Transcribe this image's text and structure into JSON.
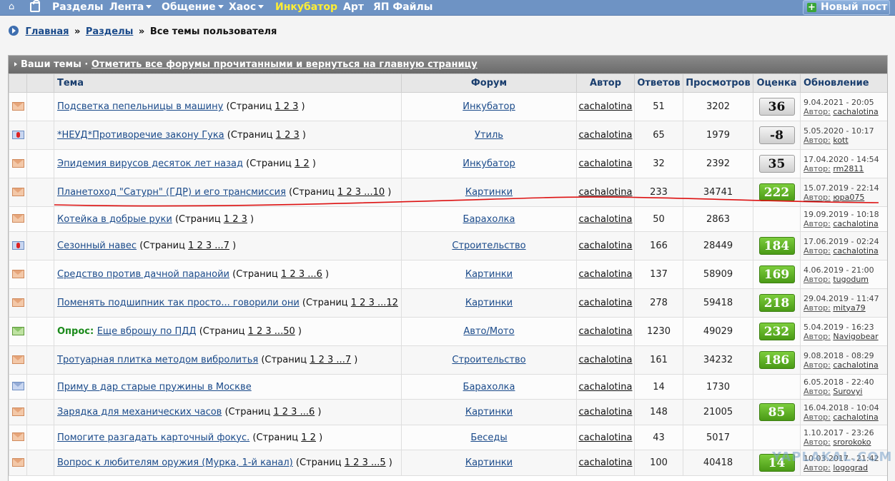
{
  "nav": {
    "items": [
      {
        "label": "Разделы",
        "caret": false
      },
      {
        "label": "Лента",
        "caret": true
      },
      {
        "label": "Общение",
        "caret": true
      },
      {
        "label": "Хаос",
        "caret": true
      },
      {
        "label": "Инкубатор",
        "caret": false,
        "active": true
      },
      {
        "label": "Арт",
        "caret": false
      },
      {
        "label": "ЯП Файлы",
        "caret": false
      }
    ],
    "new_post": "Новый пост"
  },
  "breadcrumb": {
    "home": "Главная",
    "sep1": "»",
    "sections": "Разделы",
    "sep2": "»",
    "current": "Все темы пользователя"
  },
  "panel": {
    "title": "Ваши темы",
    "dot": "·",
    "mark_read": "Отметить все форумы прочитанными и вернуться на главную страницу"
  },
  "columns": {
    "topic": "Тема",
    "forum": "Форум",
    "author": "Автор",
    "replies": "Ответов",
    "views": "Просмотров",
    "rating": "Оценка",
    "updated": "Обновление"
  },
  "rows": [
    {
      "icon": "envelope-icon",
      "poll": "",
      "title": "Подсветка пепельницы в машину",
      "pages_prefix": " (Страниц ",
      "pages": "1 2 3",
      "pages_suffix": " )",
      "forum": "Инкубатор",
      "author": "cachalotina",
      "replies": "51",
      "views": "3202",
      "rating": "36",
      "rating_style": "grey",
      "date": "9.04.2021 - 20:05",
      "by_label": "Автор:",
      "by": "cachalotina"
    },
    {
      "icon": "hot-icon",
      "poll": "",
      "title": "*НЕУД*Противоречие закону Гука",
      "pages_prefix": " (Страниц ",
      "pages": "1 2 3",
      "pages_suffix": " )",
      "forum": "Утиль",
      "author": "cachalotina",
      "replies": "65",
      "views": "1979",
      "rating": "-8",
      "rating_style": "grey",
      "date": "5.05.2020 - 10:17",
      "by_label": "Автор:",
      "by": "kott"
    },
    {
      "icon": "envelope-icon",
      "poll": "",
      "title": "Эпидемия вирусов десяток лет назад",
      "pages_prefix": " (Страниц ",
      "pages": "1 2",
      "pages_suffix": " )",
      "forum": "Инкубатор",
      "author": "cachalotina",
      "replies": "32",
      "views": "2392",
      "rating": "35",
      "rating_style": "grey",
      "date": "17.04.2020 - 14:54",
      "by_label": "Автор:",
      "by": "rm2811"
    },
    {
      "icon": "envelope-icon",
      "poll": "",
      "title": "Планетоход \"Сатурн\" (ГДР) и его трансмиссия",
      "pages_prefix": " (Страниц ",
      "pages": "1 2 3 ...10",
      "pages_suffix": " )",
      "forum": "Картинки",
      "author": "cachalotina",
      "replies": "233",
      "views": "34741",
      "rating": "222",
      "rating_style": "green",
      "date": "15.07.2019 - 22:14",
      "by_label": "Автор:",
      "by": "юра075"
    },
    {
      "icon": "envelope-icon",
      "poll": "",
      "title": "Котейка в добрые руки",
      "pages_prefix": " (Страниц ",
      "pages": "1 2 3",
      "pages_suffix": " )",
      "forum": "Барахолка",
      "author": "cachalotina",
      "replies": "50",
      "views": "2863",
      "rating": "",
      "rating_style": "none",
      "date": "19.09.2019 - 10:18",
      "by_label": "Автор:",
      "by": "cachalotina"
    },
    {
      "icon": "hot-icon",
      "poll": "",
      "title": "Сезонный навес",
      "pages_prefix": " (Страниц ",
      "pages": "1 2 3 ...7",
      "pages_suffix": " )",
      "forum": "Строительство",
      "author": "cachalotina",
      "replies": "166",
      "views": "28449",
      "rating": "184",
      "rating_style": "green",
      "date": "17.06.2019 - 02:24",
      "by_label": "Автор:",
      "by": "cachalotina"
    },
    {
      "icon": "envelope-icon",
      "poll": "",
      "title": "Средство против дачной паранойи",
      "pages_prefix": " (Страниц ",
      "pages": "1 2 3 ...6",
      "pages_suffix": " )",
      "forum": "Картинки",
      "author": "cachalotina",
      "replies": "137",
      "views": "58909",
      "rating": "169",
      "rating_style": "green",
      "date": "4.06.2019 - 21:00",
      "by_label": "Автор:",
      "by": "tugodum"
    },
    {
      "icon": "envelope-icon",
      "poll": "",
      "title": "Поменять подшипник так просто... говорили они",
      "pages_prefix": " (Страниц ",
      "pages": "1 2 3 ...12",
      "pages_suffix": " )",
      "forum": "Картинки",
      "author": "cachalotina",
      "replies": "278",
      "views": "59418",
      "rating": "218",
      "rating_style": "green",
      "date": "29.04.2019 - 11:47",
      "by_label": "Автор:",
      "by": "mitya79"
    },
    {
      "icon": "poll-envelope-icon",
      "poll": "Опрос: ",
      "title": "Еще вброшу по ПДД",
      "pages_prefix": " (Страниц ",
      "pages": "1 2 3 ...50",
      "pages_suffix": " )",
      "forum": "Авто/Мото",
      "author": "cachalotina",
      "replies": "1230",
      "views": "49029",
      "rating": "232",
      "rating_style": "green",
      "date": "5.04.2019 - 16:23",
      "by_label": "Автор:",
      "by": "Navigobear"
    },
    {
      "icon": "envelope-icon",
      "poll": "",
      "title": "Тротуарная плитка методом вибролитья",
      "pages_prefix": " (Страниц ",
      "pages": "1 2 3 ...7",
      "pages_suffix": " )",
      "forum": "Строительство",
      "author": "cachalotina",
      "replies": "161",
      "views": "34232",
      "rating": "186",
      "rating_style": "green",
      "date": "9.08.2018 - 08:29",
      "by_label": "Автор:",
      "by": "cachalotina"
    },
    {
      "icon": "envelope-blue-icon",
      "poll": "",
      "title": "Приму в дар старые пружины в Москве",
      "pages_prefix": "",
      "pages": "",
      "pages_suffix": "",
      "forum": "Барахолка",
      "author": "cachalotina",
      "replies": "14",
      "views": "1730",
      "rating": "",
      "rating_style": "none",
      "date": "6.05.2018 - 22:40",
      "by_label": "Автор:",
      "by": "Surovyi"
    },
    {
      "icon": "envelope-icon",
      "poll": "",
      "title": "Зарядка для механических часов",
      "pages_prefix": " (Страниц ",
      "pages": "1 2 3 ...6",
      "pages_suffix": " )",
      "forum": "Картинки",
      "author": "cachalotina",
      "replies": "148",
      "views": "21005",
      "rating": "85",
      "rating_style": "green",
      "date": "16.04.2018 - 10:04",
      "by_label": "Автор:",
      "by": "cachalotina"
    },
    {
      "icon": "envelope-icon",
      "poll": "",
      "title": "Помогите разгадать карточный фокус.",
      "pages_prefix": " (Страниц ",
      "pages": "1 2",
      "pages_suffix": " )",
      "forum": "Беседы",
      "author": "cachalotina",
      "replies": "43",
      "views": "5017",
      "rating": "",
      "rating_style": "none",
      "date": "1.10.2017 - 23:26",
      "by_label": "Автор:",
      "by": "srorokoko"
    },
    {
      "icon": "envelope-icon",
      "poll": "",
      "title": "Вопрос к любителям оружия (Мурка, 1-й канал)",
      "pages_prefix": " (Страниц ",
      "pages": "1 2 3 ...5",
      "pages_suffix": " )",
      "forum": "Картинки",
      "author": "cachalotina",
      "replies": "100",
      "views": "40418",
      "rating": "14",
      "rating_style": "green",
      "date": "10.03.2017 - 21:42",
      "by_label": "Автор:",
      "by": "logograd"
    }
  ],
  "watermark": "YAPLAKAL.COM",
  "colors": {
    "nav_bg": "#6e93c4",
    "active_nav": "#ffee33",
    "link": "#1a4a8a",
    "rating_green": "#4a9a16",
    "annotation_line": "#dd1111"
  }
}
